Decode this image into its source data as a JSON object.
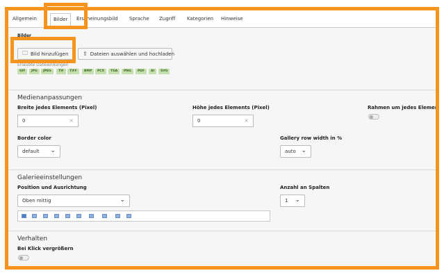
{
  "tabs": [
    "Allgemein",
    "Bilder",
    "Erscheinungsbild",
    "Sprache",
    "Zugriff",
    "Kategorien",
    "Hinweise"
  ],
  "images": {
    "heading": "Bilder",
    "add_image_button": "Bild hinzufügen",
    "select_upload_button": "Dateien auswählen und hochladen",
    "allowed_types_label": "Erlaubte Dateiendungen",
    "file_types": [
      "GIF",
      "JPG",
      "JPEG",
      "TIF",
      "TIFF",
      "BMP",
      "PCX",
      "TGA",
      "PNG",
      "PDF",
      "AI",
      "SVG"
    ]
  },
  "media": {
    "title": "Medienanpassungen",
    "width_label": "Breite jedes Elements (Pixel)",
    "width_value": "0",
    "height_label": "Höhe jedes Elements (Pixel)",
    "height_value": "0",
    "border_frame_label": "Rahmen um jedes Element",
    "border_color_label": "Border color",
    "border_color_value": "default",
    "gallery_row_label": "Gallery row width in %",
    "gallery_row_value": "auto"
  },
  "gallery": {
    "title": "Galerieeinstellungen",
    "position_label": "Position und Ausrichtung",
    "position_value": "Oben mittig",
    "columns_label": "Anzahl an Spalten",
    "columns_value": "1"
  },
  "behavior": {
    "title": "Verhalten",
    "enlarge_label": "Bei Klick vergrößern"
  },
  "icons": {
    "clear": "×",
    "chevron": "⌄",
    "folder": "🗀",
    "upload": "⇪"
  },
  "colors": {
    "accent": "#f7941d",
    "tag_bg": "#c6dfb0"
  }
}
